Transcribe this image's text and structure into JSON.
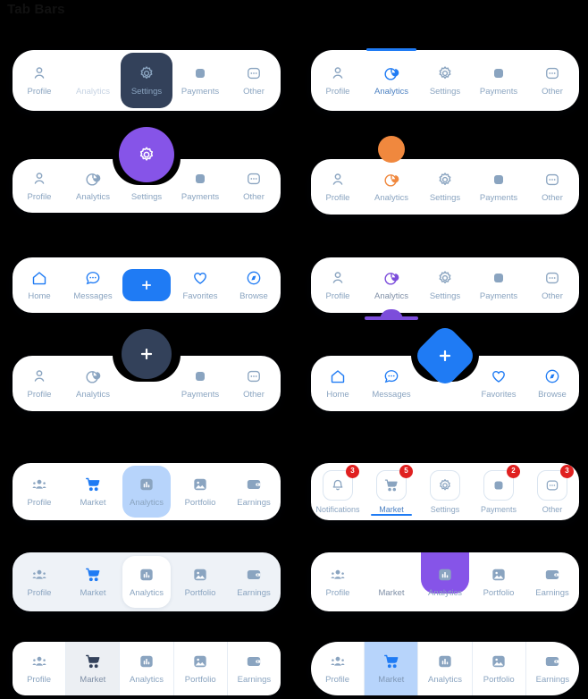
{
  "page": {
    "title": "Tab Bars",
    "background": "#000000"
  },
  "colors": {
    "accent_blue": "#1f7bf4",
    "purple": "#8654e8",
    "purple_dark": "#7c4ddb",
    "orange": "#f0883e",
    "dark_navy": "#33415a",
    "label_blue": "#8aa4c0",
    "badge_red": "#e02020",
    "soft_blue": "#b7d4fb",
    "bar_grey": "#eef2f7"
  },
  "bars": [
    {
      "id": "bar1L",
      "name": "tabbar-dark-pill",
      "style": "dark-active-pill",
      "tabs": [
        {
          "label": "Profile",
          "icon": "person-icon",
          "active": false
        },
        {
          "label": "Analytics",
          "icon": "piechart-icon",
          "active": true
        },
        {
          "label": "Settings",
          "icon": "gear-icon",
          "active": false
        },
        {
          "label": "Payments",
          "icon": "card-icon",
          "active": false
        },
        {
          "label": "Other",
          "icon": "dots-box-icon",
          "active": false
        }
      ]
    },
    {
      "id": "bar1R",
      "name": "tabbar-top-indicator",
      "style": "top-line-indicator",
      "tabs": [
        {
          "label": "Profile",
          "icon": "person-icon",
          "active": false
        },
        {
          "label": "Analytics",
          "icon": "piechart-icon",
          "active": true
        },
        {
          "label": "Settings",
          "icon": "gear-icon",
          "active": false
        },
        {
          "label": "Payments",
          "icon": "card-icon",
          "active": false
        },
        {
          "label": "Other",
          "icon": "dots-box-icon",
          "active": false
        }
      ]
    },
    {
      "id": "bar2L",
      "name": "tabbar-purple-fab",
      "style": "floating-circle-notch",
      "fab": {
        "icon": "gear-icon",
        "color": "#8654e8",
        "name": "settings-fab"
      },
      "tabs": [
        {
          "label": "Profile",
          "icon": "person-icon",
          "active": false
        },
        {
          "label": "Analytics",
          "icon": "piechart-icon",
          "active": false
        },
        {
          "label": "Settings",
          "icon": "none",
          "active": true
        },
        {
          "label": "Payments",
          "icon": "card-icon",
          "active": false
        },
        {
          "label": "Other",
          "icon": "dots-box-icon",
          "active": false
        }
      ]
    },
    {
      "id": "bar2R",
      "name": "tabbar-orange-dot",
      "style": "floating-dot-indicator",
      "dot": {
        "color": "#f0883e",
        "name": "active-dot-indicator"
      },
      "tabs": [
        {
          "label": "Profile",
          "icon": "person-icon",
          "active": false
        },
        {
          "label": "Analytics",
          "icon": "piechart-icon",
          "active": true
        },
        {
          "label": "Settings",
          "icon": "gear-icon",
          "active": false
        },
        {
          "label": "Payments",
          "icon": "card-icon",
          "active": false
        },
        {
          "label": "Other",
          "icon": "dots-box-icon",
          "active": false
        }
      ]
    },
    {
      "id": "bar3L",
      "name": "tabbar-center-plus-rect",
      "style": "center-action-rect",
      "action": {
        "icon": "plus-icon",
        "color": "#1f7bf4",
        "name": "add-button"
      },
      "tabs": [
        {
          "label": "Home",
          "icon": "home-icon",
          "active": false
        },
        {
          "label": "Messages",
          "icon": "chat-icon",
          "active": false
        },
        {
          "label": "",
          "icon": "plus-rect",
          "active": false
        },
        {
          "label": "Favorites",
          "icon": "heart-icon",
          "active": false
        },
        {
          "label": "Browse",
          "icon": "compass-icon",
          "active": false
        }
      ]
    },
    {
      "id": "bar3R",
      "name": "tabbar-bottom-arc",
      "style": "bottom-arc-indicator",
      "tabs": [
        {
          "label": "Profile",
          "icon": "person-icon",
          "active": false
        },
        {
          "label": "Analytics",
          "icon": "piechart-icon",
          "active": true
        },
        {
          "label": "Settings",
          "icon": "gear-icon",
          "active": false
        },
        {
          "label": "Payments",
          "icon": "card-icon",
          "active": false
        },
        {
          "label": "Other",
          "icon": "dots-box-icon",
          "active": false
        }
      ]
    },
    {
      "id": "bar4L",
      "name": "tabbar-dark-fab",
      "style": "floating-circle-notch",
      "fab": {
        "icon": "plus-icon",
        "color": "#33415a",
        "name": "add-fab"
      },
      "tabs": [
        {
          "label": "Profile",
          "icon": "person-icon",
          "active": false
        },
        {
          "label": "Analytics",
          "icon": "piechart-icon",
          "active": false
        },
        {
          "label": "Payments",
          "icon": "card-icon",
          "active": false
        },
        {
          "label": "Other",
          "icon": "dots-box-icon",
          "active": false
        }
      ]
    },
    {
      "id": "bar4R",
      "name": "tabbar-diamond-fab",
      "style": "floating-diamond-notch",
      "fab": {
        "icon": "plus-icon",
        "color": "#1f7bf4",
        "name": "add-fab-diamond"
      },
      "tabs": [
        {
          "label": "Home",
          "icon": "home-icon",
          "active": false
        },
        {
          "label": "Messages",
          "icon": "chat-icon",
          "active": false
        },
        {
          "label": "Favorites",
          "icon": "heart-icon",
          "active": false
        },
        {
          "label": "Browse",
          "icon": "compass-icon",
          "active": false
        }
      ]
    },
    {
      "id": "bar5L",
      "name": "tabbar-soft-blue-pill",
      "style": "soft-active-pill",
      "tabs": [
        {
          "label": "Profile",
          "icon": "people-icon",
          "active": false
        },
        {
          "label": "Market",
          "icon": "cart-icon",
          "active": true
        },
        {
          "label": "Analytics",
          "icon": "barchart-icon",
          "active": false
        },
        {
          "label": "Portfolio",
          "icon": "image-icon",
          "active": false
        },
        {
          "label": "Earnings",
          "icon": "wallet-icon",
          "active": false
        }
      ]
    },
    {
      "id": "bar5R",
      "name": "tabbar-badges",
      "style": "boxed-icons-with-badges",
      "tabs": [
        {
          "label": "Notifications",
          "icon": "bell-icon",
          "badge": "3",
          "active": false
        },
        {
          "label": "Market",
          "icon": "cart-icon",
          "badge": "5",
          "active": true
        },
        {
          "label": "Settings",
          "icon": "gear-icon",
          "badge": "",
          "active": false
        },
        {
          "label": "Payments",
          "icon": "card-icon",
          "badge": "2",
          "active": false
        },
        {
          "label": "Other",
          "icon": "dots-box-icon",
          "badge": "3",
          "active": false
        }
      ]
    },
    {
      "id": "bar6L",
      "name": "tabbar-grey-white-pill",
      "style": "grey-bar-white-active",
      "tabs": [
        {
          "label": "Profile",
          "icon": "people-icon",
          "active": false
        },
        {
          "label": "Market",
          "icon": "cart-icon",
          "active": true
        },
        {
          "label": "Analytics",
          "icon": "barchart-icon",
          "active": false
        },
        {
          "label": "Portfolio",
          "icon": "image-icon",
          "active": false
        },
        {
          "label": "Earnings",
          "icon": "wallet-icon",
          "active": false
        }
      ]
    },
    {
      "id": "bar6R",
      "name": "tabbar-purple-tall-tab",
      "style": "tall-purple-active",
      "tabs": [
        {
          "label": "Profile",
          "icon": "people-icon",
          "active": false
        },
        {
          "label": "Market",
          "icon": "cart-icon",
          "active": true
        },
        {
          "label": "Analytics",
          "icon": "barchart-icon",
          "active": false
        },
        {
          "label": "Portfolio",
          "icon": "image-icon",
          "active": false
        },
        {
          "label": "Earnings",
          "icon": "wallet-icon",
          "active": false
        }
      ]
    },
    {
      "id": "bar7L",
      "name": "tabbar-segmented-grey",
      "style": "segmented-dividers",
      "tabs": [
        {
          "label": "Profile",
          "icon": "people-icon",
          "active": false
        },
        {
          "label": "Market",
          "icon": "cart-icon",
          "active": true
        },
        {
          "label": "Analytics",
          "icon": "barchart-icon",
          "active": false
        },
        {
          "label": "Portfolio",
          "icon": "image-icon",
          "active": false
        },
        {
          "label": "Earnings",
          "icon": "wallet-icon",
          "active": false
        }
      ]
    },
    {
      "id": "bar7R",
      "name": "tabbar-segmented-pill",
      "style": "segmented-pill-blue",
      "tabs": [
        {
          "label": "Profile",
          "icon": "people-icon",
          "active": false
        },
        {
          "label": "Market",
          "icon": "cart-icon",
          "active": true
        },
        {
          "label": "Analytics",
          "icon": "barchart-icon",
          "active": false
        },
        {
          "label": "Portfolio",
          "icon": "image-icon",
          "active": false
        },
        {
          "label": "Earnings",
          "icon": "wallet-icon",
          "active": false
        }
      ]
    }
  ]
}
